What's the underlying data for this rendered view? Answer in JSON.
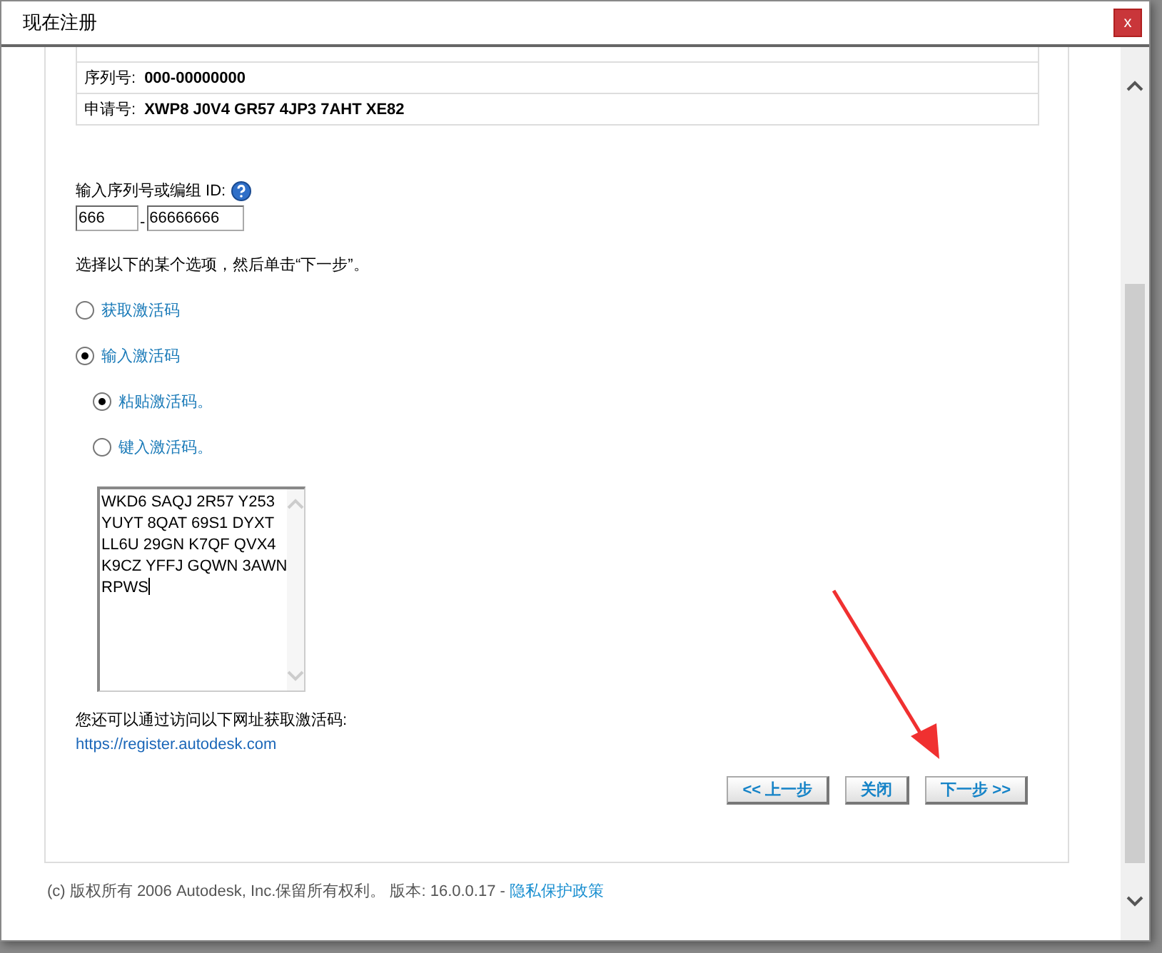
{
  "window": {
    "title": "现在注册",
    "close": "x"
  },
  "info_rows": [
    {
      "label": "序列号:",
      "value": "000-00000000"
    },
    {
      "label": "申请号:",
      "value": "XWP8 J0V4 GR57 4JP3 7AHT XE82"
    }
  ],
  "serial": {
    "label": "输入序列号或编组 ID:",
    "prefix": "666",
    "separator": "-",
    "number": "66666666"
  },
  "instruction": "选择以下的某个选项，然后单击“下一步”。",
  "options": [
    {
      "label": "获取激活码",
      "selected": false
    },
    {
      "label": "输入激活码",
      "selected": true,
      "children": [
        {
          "label": "粘贴激活码。",
          "selected": true
        },
        {
          "label": "键入激活码。",
          "selected": false
        }
      ]
    }
  ],
  "activation_code": {
    "lines": [
      "WKD6 SAQJ 2R57 Y253",
      "YUYT 8QAT 69S1 DYXT",
      "LL6U 29GN K7QF QVX4",
      "K9CZ YFFJ GQWN 3AWN",
      "RPWS"
    ]
  },
  "hint": "您还可以通过访问以下网址获取激活码:",
  "url": "https://register.autodesk.com",
  "buttons": [
    "<< 上一步",
    "关闭",
    "下一步 >>"
  ],
  "footer": {
    "text": "(c) 版权所有 2006 Autodesk, Inc.保留所有权利。 版本: 16.0.0.17 -",
    "link": "隐私保护政策"
  }
}
